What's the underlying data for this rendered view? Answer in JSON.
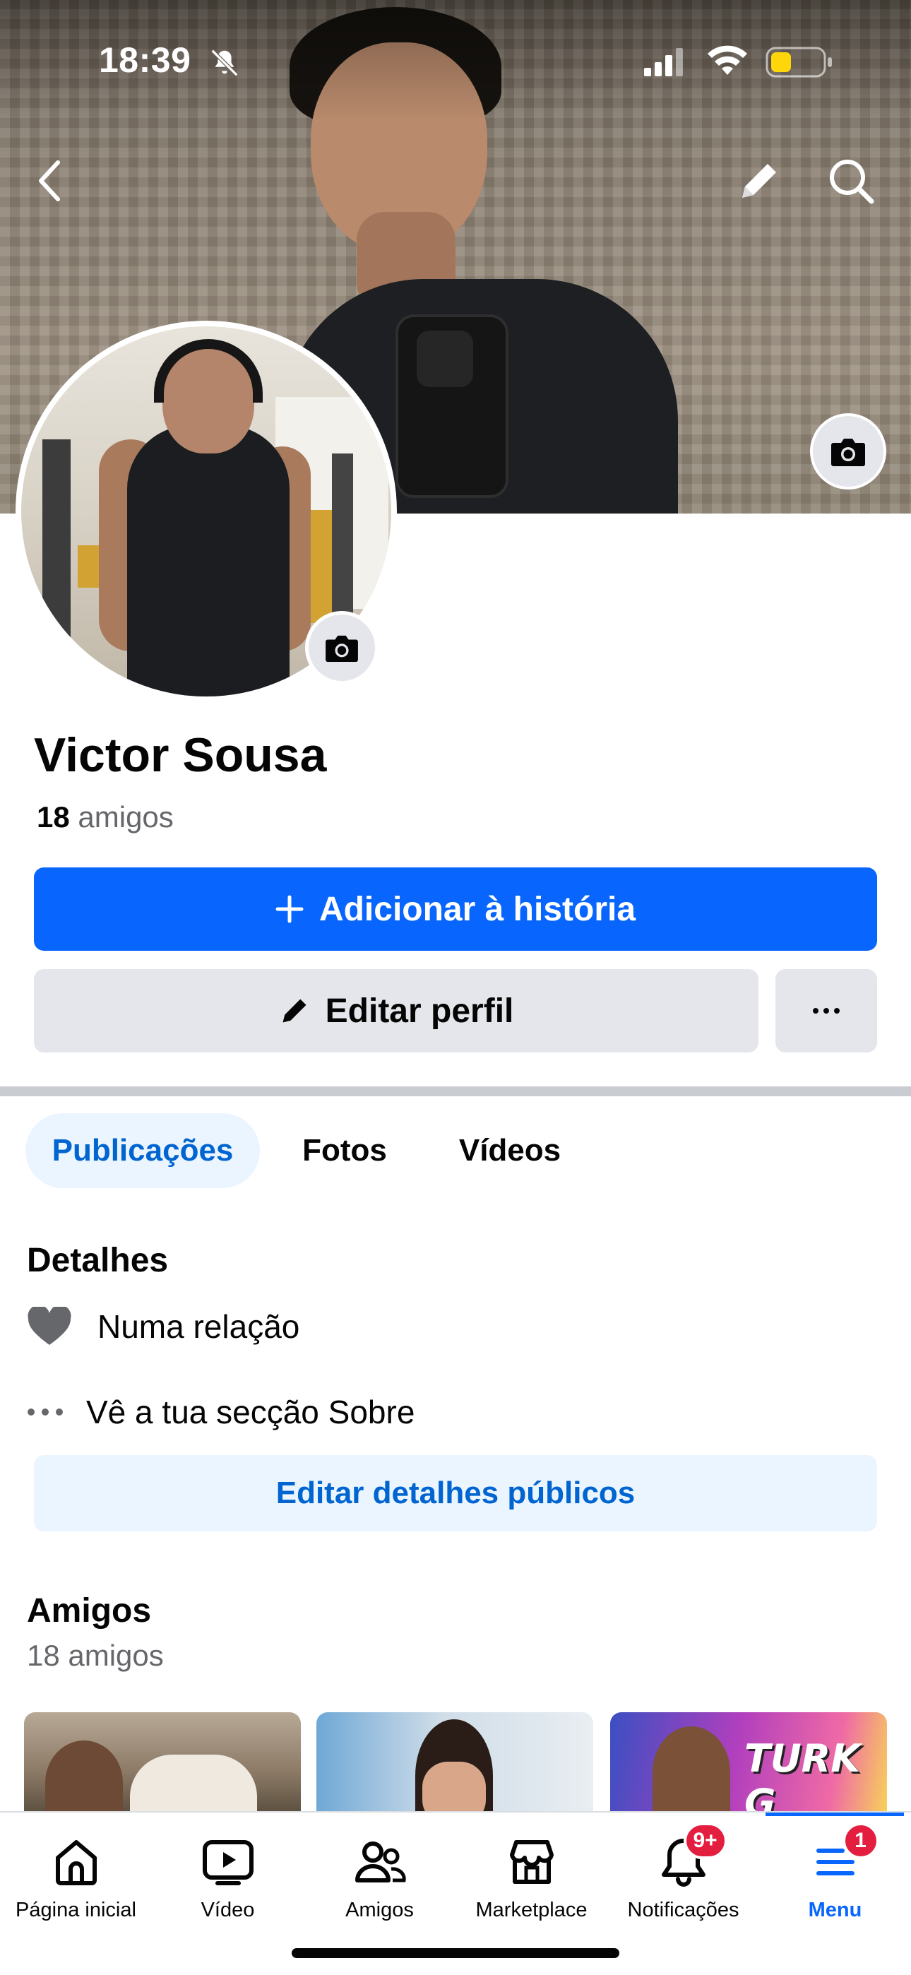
{
  "status_bar": {
    "time": "18:39"
  },
  "icons": {
    "back": "chevron-left-icon",
    "edit_cover": "pencil-icon",
    "search": "search-icon",
    "camera": "camera-icon"
  },
  "profile": {
    "name": "Victor Sousa",
    "friends_count": "18",
    "friends_word": "amigos"
  },
  "actions": {
    "add_story_label": "Adicionar à história",
    "edit_profile_label": "Editar perfil",
    "more_label": "···"
  },
  "tabs": [
    {
      "label": "Publicações",
      "active": true
    },
    {
      "label": "Fotos",
      "active": false
    },
    {
      "label": "Vídeos",
      "active": false
    }
  ],
  "details": {
    "title": "Detalhes",
    "relationship": "Numa relação",
    "about_link": "Vê a tua secção Sobre",
    "edit_button": "Editar detalhes públicos"
  },
  "friends": {
    "title": "Amigos",
    "count_text": "18 amigos",
    "cards": [
      {
        "name": "friend-1"
      },
      {
        "name": "friend-2"
      },
      {
        "name": "friend-3",
        "overlay_text": "TURK G"
      }
    ]
  },
  "bottom_nav": [
    {
      "label": "Página inicial",
      "icon": "home-icon",
      "active": false
    },
    {
      "label": "Vídeo",
      "icon": "video-icon",
      "active": false
    },
    {
      "label": "Amigos",
      "icon": "friends-icon",
      "active": false
    },
    {
      "label": "Marketplace",
      "icon": "marketplace-icon",
      "active": false
    },
    {
      "label": "Notificações",
      "icon": "bell-icon",
      "active": false,
      "badge": "9+"
    },
    {
      "label": "Menu",
      "icon": "menu-icon",
      "active": true,
      "badge": "1"
    }
  ],
  "colors": {
    "accent": "#0866ff",
    "accent_text": "#0064d1",
    "light_accent_bg": "#ebf5ff",
    "secondary_button": "#e4e6eb",
    "badge": "#e41e3f",
    "muted_text": "#65676b"
  }
}
